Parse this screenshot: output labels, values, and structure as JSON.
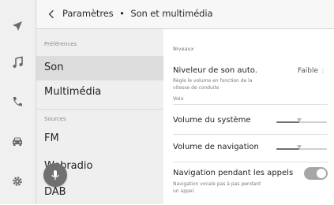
{
  "header": {
    "breadcrumb_parent": "Paramètres",
    "breadcrumb_sep": "•",
    "breadcrumb_current": "Son et multimédia"
  },
  "rail": {
    "icons": [
      "navigation-arrow-icon",
      "music-note-icon",
      "phone-icon",
      "car-icon",
      "gear-icon"
    ]
  },
  "sidebar": {
    "section_preferences": "Préférences",
    "items_preferences": [
      {
        "label": "Son",
        "active": true
      },
      {
        "label": "Multimédia",
        "active": false
      }
    ],
    "section_sources": "Sources",
    "items_sources": [
      {
        "label": "FM"
      },
      {
        "label": "Webradio"
      },
      {
        "label": "DAB"
      }
    ]
  },
  "main": {
    "section_niveaux": "Niveaux",
    "auto_leveler": {
      "title": "Niveleur de son auto.",
      "value": "Faible",
      "more": "⋮",
      "desc": "Règle le volume en fonction de la vitesse de conduite"
    },
    "section_voix": "Voix",
    "system_volume": {
      "title": "Volume du système",
      "level": 0.45
    },
    "nav_volume": {
      "title": "Volume de navigation",
      "level": 0.45
    },
    "nav_during_calls": {
      "title": "Navigation pendant les appels",
      "desc": "Navigation vocale pas à pas pendant un appel.",
      "on": true
    }
  },
  "colors": {
    "active_item": "#dcdcdc",
    "panel": "#efefef",
    "toggle": "#a6a6a6"
  }
}
